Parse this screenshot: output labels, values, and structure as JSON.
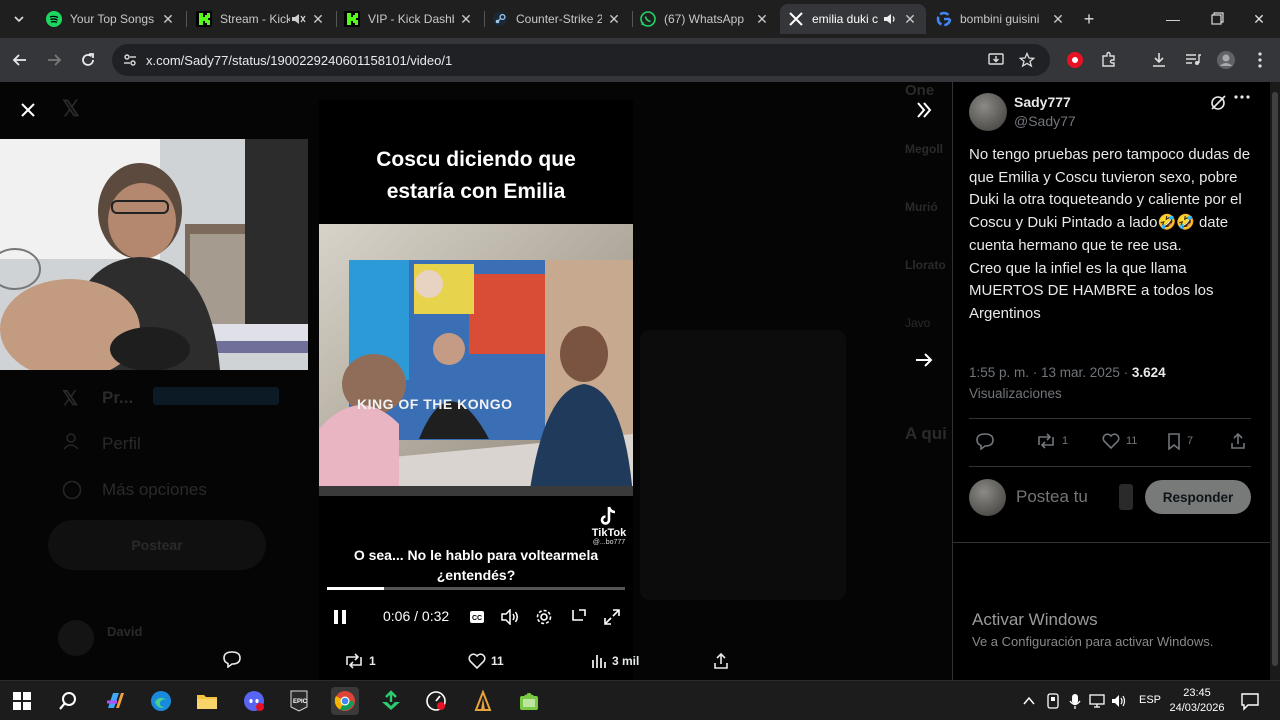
{
  "browser": {
    "tabs": [
      {
        "title": "Your Top Songs",
        "icon": "spotify-icon",
        "color": "#1ed760"
      },
      {
        "title": "Stream - Kick",
        "icon": "kick-icon",
        "color": "#53fc18",
        "muted": true
      },
      {
        "title": "VIP - Kick Dashboard",
        "icon": "kick-icon",
        "color": "#53fc18"
      },
      {
        "title": "Counter-Strike 2",
        "icon": "steam-icon",
        "color": "#9ec8ec"
      },
      {
        "title": "(67) WhatsApp",
        "icon": "whatsapp-icon",
        "color": "#25d366"
      },
      {
        "title": "emilia duki c",
        "icon": "x-icon",
        "color": "#ffffff",
        "audio": true,
        "active": true
      },
      {
        "title": "bombini guisini",
        "icon": "google-icon",
        "color": "#4285f4"
      }
    ],
    "url": "x.com/Sady77/status/1900229240601158101/video/1"
  },
  "video": {
    "title": "Coscu diciendo que estaría con Emilia",
    "caption": "O sea... No le hablo para voltearmela ¿entendés?",
    "watermark": "TikTok",
    "watermark_user": "@...bo777",
    "time": "0:06 / 0:32",
    "progress": 0.19,
    "mural_text": "KING OF THE KONGO",
    "stats": {
      "retweets": "1",
      "likes": "11",
      "views": "3 mil"
    }
  },
  "tweet": {
    "author_name": "Sady777",
    "author_handle": "@Sady77",
    "text": "No tengo pruebas pero tampoco dudas de que Emilia y Coscu tuvieron sexo, pobre Duki la otra toqueteando y caliente por el Coscu y Duki Pintado a lado🤣🤣 date cuenta hermano que te ree usa.\nCreo que la infiel es la que llama MUERTOS DE HAMBRE a todos los Argentinos",
    "timestamp": "1:55 p. m. · 13 mar. 2025 · ",
    "views_count": "3.624",
    "views_label": "Visualizaciones",
    "actions": {
      "reposts": "1",
      "likes": "11",
      "bookmarks": "7"
    },
    "reply_placeholder": "Postea tu",
    "reply_button": "Responder"
  },
  "background": {
    "sidebar_items": [
      "Pr...",
      "Perfil",
      "Más opciones"
    ],
    "post_button": "Postear",
    "user_name": "David",
    "trend_heading": "A qui",
    "trends": [
      "Megoll",
      "Murió",
      "Llorato",
      "Javo"
    ],
    "one_label": "One"
  },
  "windows": {
    "watermark_title": "Activar Windows",
    "watermark_sub": "Ve a Configuración para activar Windows.",
    "lang": "ESP",
    "time": "23:45",
    "date": "24/03/2026"
  }
}
